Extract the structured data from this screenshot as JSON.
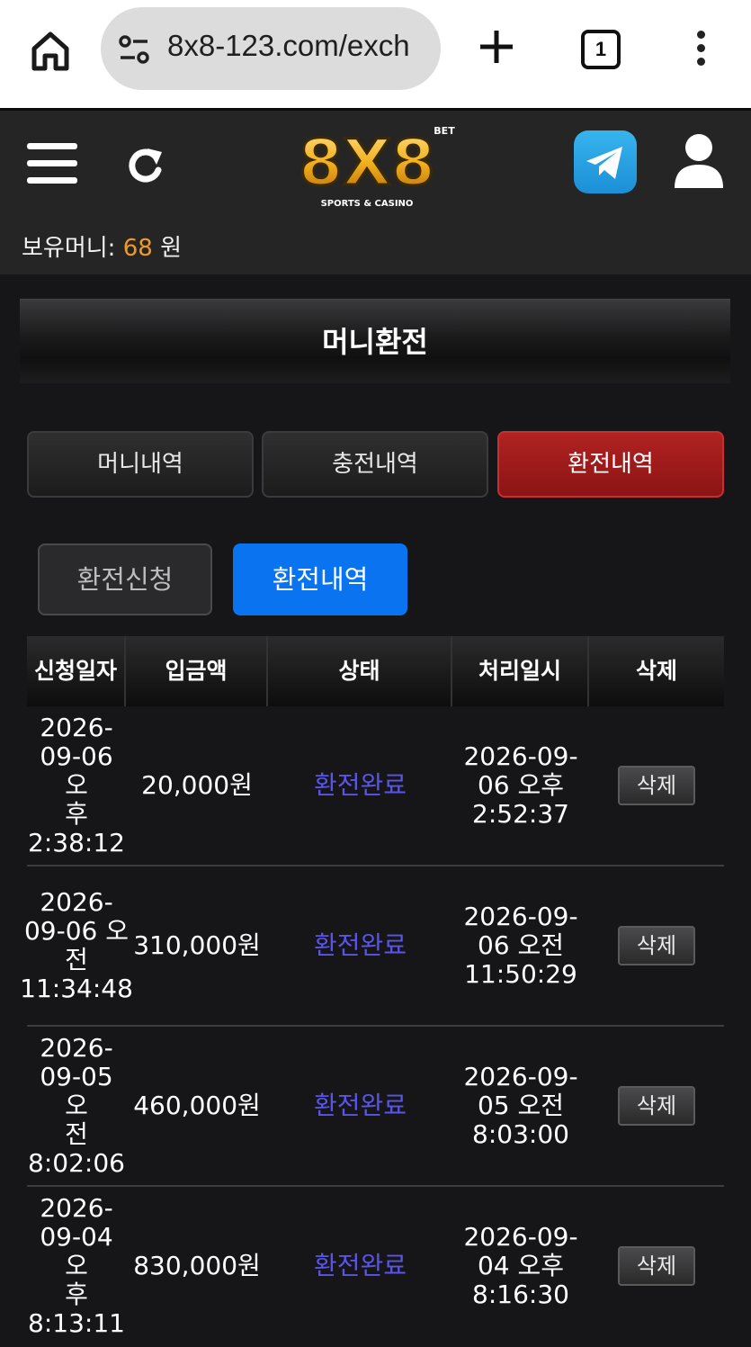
{
  "browser": {
    "url": "8x8-123.com/exch",
    "tab_count": "1"
  },
  "header": {
    "logo_main": "8X8",
    "logo_sup": "BET",
    "logo_sub": "SPORTS & CASINO",
    "balance_label": "보유머니:",
    "balance_amount": "68",
    "balance_unit": "원"
  },
  "page": {
    "title": "머니환전"
  },
  "main_tabs": [
    {
      "label": "머니내역",
      "active": false
    },
    {
      "label": "충전내역",
      "active": false
    },
    {
      "label": "환전내역",
      "active": true
    }
  ],
  "sub_tabs": [
    {
      "label": "환전신청",
      "active": false
    },
    {
      "label": "환전내역",
      "active": true
    }
  ],
  "table": {
    "headers": [
      "신청일자",
      "입금액",
      "상태",
      "처리일시",
      "삭제"
    ],
    "rows": [
      {
        "requested": "2026-\n09-06 오\n후\n2:38:12",
        "amount": "20,000원",
        "status": "환전완료",
        "processed": "2026-09-\n06 오후\n2:52:37",
        "delete": "삭제"
      },
      {
        "requested": "2026-\n09-06 오\n전\n11:34:48",
        "amount": "310,000원",
        "status": "환전완료",
        "processed": "2026-09-\n06 오전\n11:50:29",
        "delete": "삭제"
      },
      {
        "requested": "2026-\n09-05 오\n전\n8:02:06",
        "amount": "460,000원",
        "status": "환전완료",
        "processed": "2026-09-\n05 오전\n8:03:00",
        "delete": "삭제"
      },
      {
        "requested": "2026-\n09-04 오\n후\n8:13:11",
        "amount": "830,000원",
        "status": "환전완료",
        "processed": "2026-09-\n04 오후\n8:16:30",
        "delete": "삭제"
      }
    ]
  },
  "colors": {
    "accent_red": "#b22222",
    "accent_blue": "#0a73f0",
    "status_purple": "#5a55e8",
    "balance_orange": "#f09a26"
  }
}
